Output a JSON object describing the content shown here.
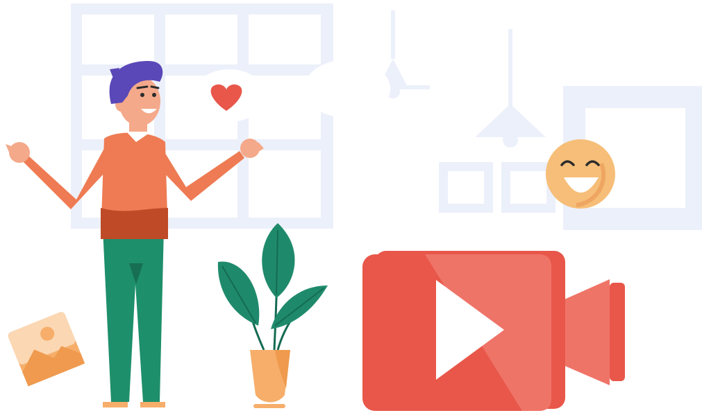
{
  "scene": {
    "icons": {
      "window": "window-icon",
      "lamps": "pendant-lamp-icon",
      "picture_frames": "picture-frame-icon",
      "person": "presenter-man-icon",
      "heart_bubble": "heart-speech-bubble-icon",
      "smiley": "laughing-emoji-icon",
      "plant": "potted-plant-icon",
      "photo": "image-icon",
      "video_camera": "video-camera-play-icon"
    },
    "colors": {
      "background_shapes": "#ECF0FA",
      "accent_red": "#E8574A",
      "accent_red_light": "#EF7468",
      "shirt": "#EE7B53",
      "pants": "#1E8F6B",
      "hair": "#5A47B8",
      "skin": "#F4A98A",
      "plant_leaf": "#1F8A6B",
      "pot": "#F6AE6A",
      "emoji": "#F6BE78"
    }
  }
}
